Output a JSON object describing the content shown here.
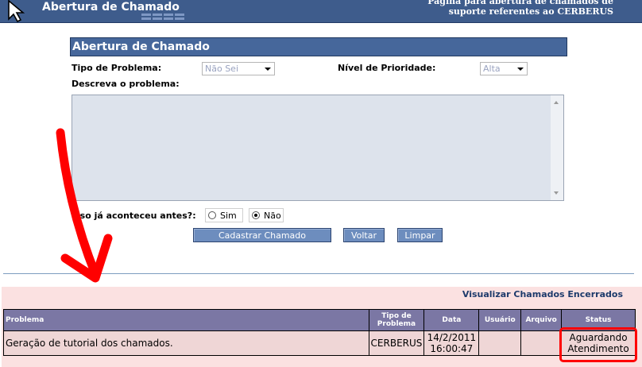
{
  "header": {
    "title": "Abertura de Chamado",
    "subtitle_line1": "Página para abertura de chamados de",
    "subtitle_line2": "suporte referentes ao CERBERUS"
  },
  "form": {
    "panel_title": "Abertura de Chamado",
    "problem_type_label": "Tipo de Problema:",
    "problem_type_value": "Não Sei",
    "priority_label": "Nível de Prioridade:",
    "priority_value": "Alta",
    "describe_label": "Descreva o problema:",
    "description_value": "",
    "happened_before_label": "Isso já aconteceu antes?:",
    "option_yes": "Sim",
    "option_no": "Não",
    "selected_option": "Não",
    "submit_button": "Cadastrar Chamado",
    "back_button": "Voltar",
    "clear_button": "Limpar"
  },
  "closed_tickets": {
    "link_label": "Visualizar Chamados Encerrados",
    "columns": [
      "Problema",
      "Tipo de Problema",
      "Data",
      "Usuário",
      "Arquivo",
      "Status"
    ],
    "rows": [
      {
        "problem": "Geração de tutorial dos chamados.",
        "type": "CERBERUS",
        "date": "14/2/2011",
        "time": "16:00:47",
        "user": "",
        "file": "",
        "status_line1": "Aguardando",
        "status_line2": "Atendimento"
      }
    ]
  },
  "colors": {
    "header_bg": "#3e5c8c",
    "panel_title_bg": "#46679b",
    "button_bg": "#6d8dbe",
    "tickets_area_bg": "#fbe1e1",
    "table_header_bg": "#7b77a4",
    "annotation_red": "#ff0000"
  }
}
